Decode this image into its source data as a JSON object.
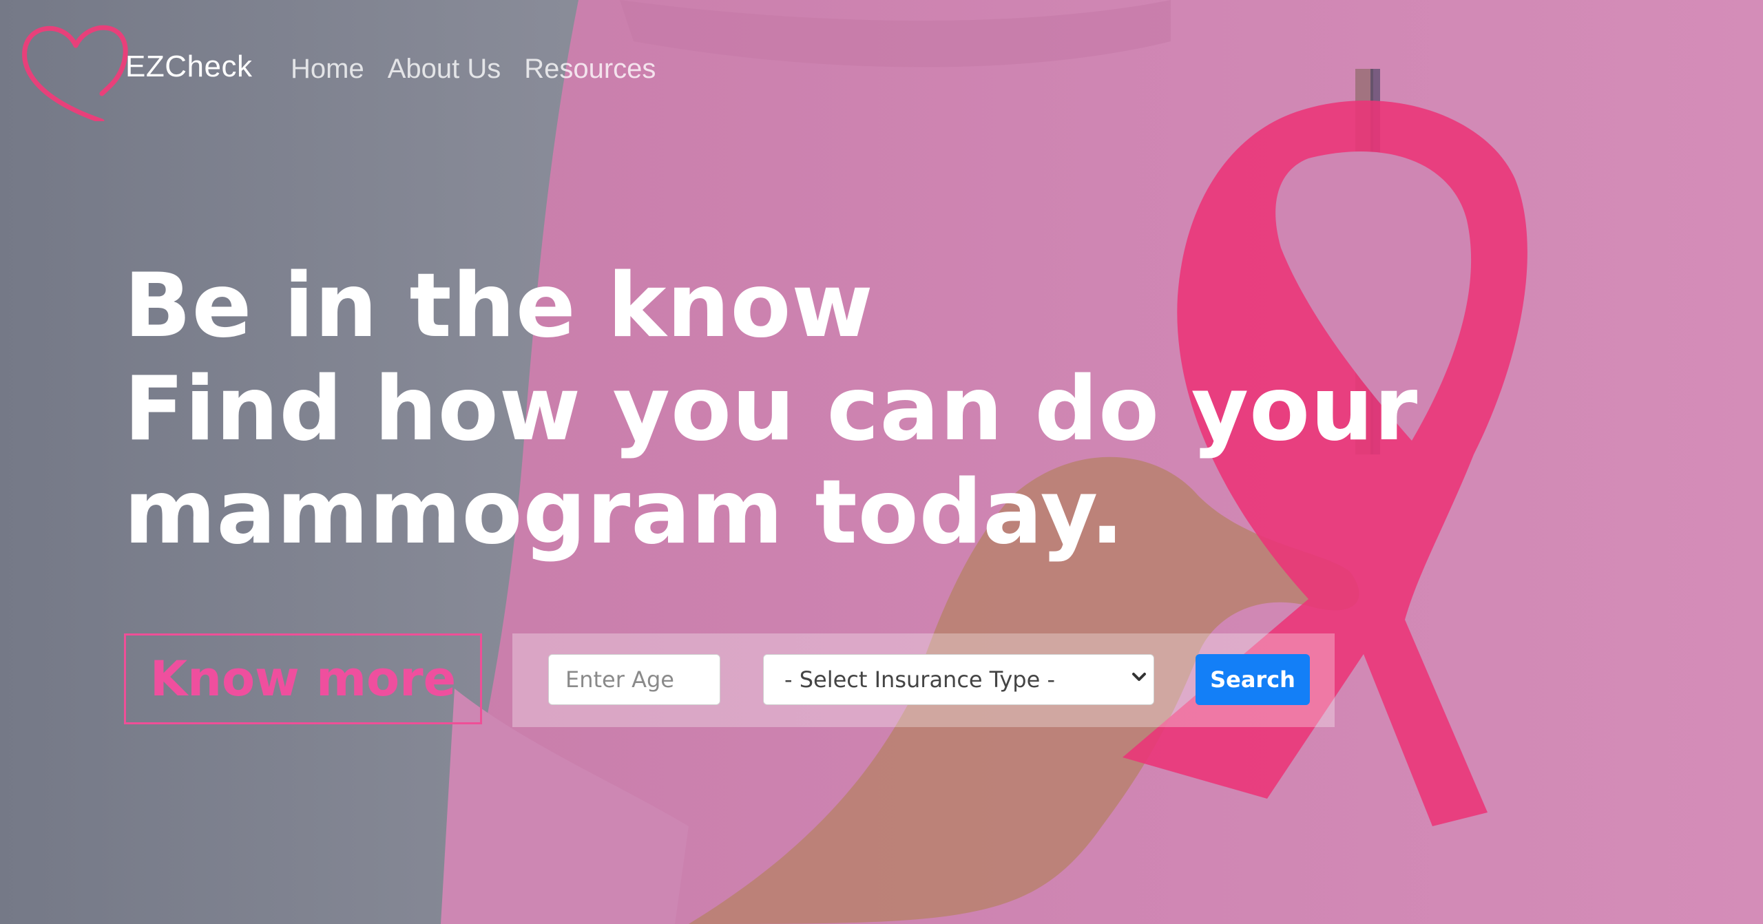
{
  "brand": {
    "name": "EZCheck",
    "logo_icon": "heart-outline-icon",
    "logo_color": "#e8407a"
  },
  "nav": {
    "items": [
      "Home",
      "About Us",
      "Resources"
    ]
  },
  "hero": {
    "headline_lines": [
      "Be in the know",
      "Find how you can do your",
      "mammogram today."
    ],
    "know_more_label": "Know more",
    "accent_color": "#ef4f9e"
  },
  "search": {
    "age_placeholder": "Enter Age",
    "insurance_selected": "- Select Insurance Type -",
    "button_label": "Search",
    "button_color": "#137ff7"
  }
}
